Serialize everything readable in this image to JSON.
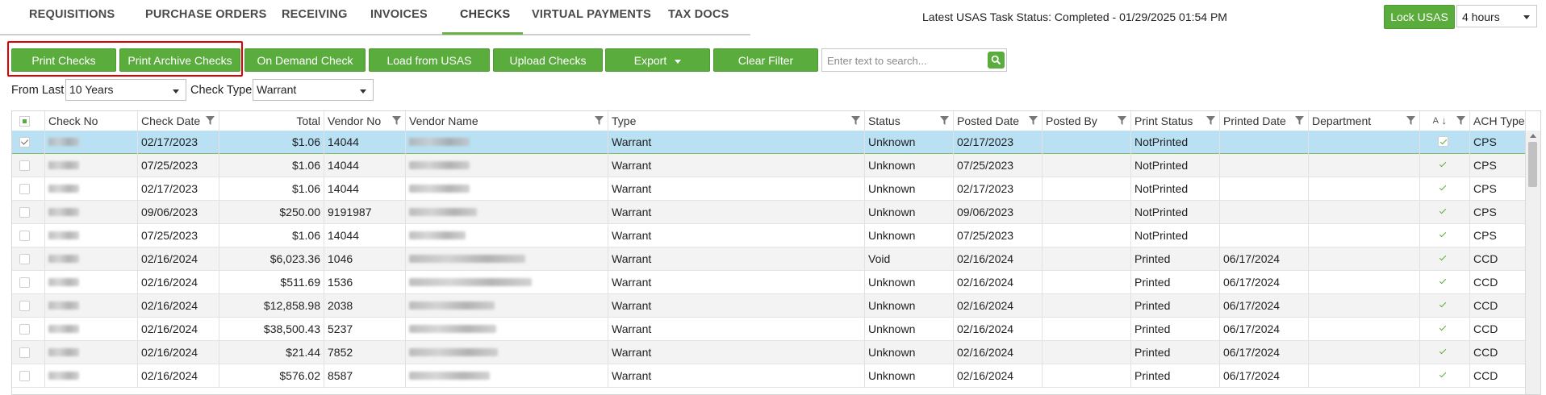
{
  "nav": {
    "tabs": [
      {
        "label": "REQUISITIONS",
        "active": false
      },
      {
        "label": "PURCHASE ORDERS",
        "active": false
      },
      {
        "label": "RECEIVING",
        "active": false
      },
      {
        "label": "INVOICES",
        "active": false
      },
      {
        "label": "CHECKS",
        "active": true
      },
      {
        "label": "VIRTUAL PAYMENTS",
        "active": false
      },
      {
        "label": "TAX DOCS",
        "active": false
      }
    ]
  },
  "header": {
    "task_status": "Latest USAS Task Status: Completed - 01/29/2025 01:54 PM",
    "lock_label": "Lock USAS",
    "hours_value": "4 hours"
  },
  "toolbar": {
    "print_checks": "Print Checks",
    "print_archive_checks": "Print Archive Checks",
    "on_demand_check": "On Demand Check",
    "load_from_usas": "Load from USAS",
    "upload_checks": "Upload Checks",
    "export": "Export",
    "clear_filter": "Clear Filter",
    "search_placeholder": "Enter text to search..."
  },
  "filters": {
    "from_last_label": "From Last",
    "from_last_value": "10 Years",
    "check_type_label": "Check Type",
    "check_type_value": "Warrant"
  },
  "colors": {
    "accent": "#5aad3c",
    "selected_row": "#b9e0f3",
    "highlight_border": "#e00000"
  },
  "grid": {
    "columns": [
      "Check No",
      "Check Date",
      "Total",
      "Vendor No",
      "Vendor Name",
      "Type",
      "Status",
      "Posted Date",
      "Posted By",
      "Print Status",
      "Printed Date",
      "Department",
      "A",
      "ACH Type"
    ],
    "rows": [
      {
        "checked": true,
        "check_date": "02/17/2023",
        "total": "$1.06",
        "vendor_no": "14044",
        "type": "Warrant",
        "status": "Unknown",
        "posted_date": "02/17/2023",
        "posted_by": "",
        "print_status": "NotPrinted",
        "printed_date": "",
        "department": "",
        "ach_type": "CPS"
      },
      {
        "checked": false,
        "check_date": "07/25/2023",
        "total": "$1.06",
        "vendor_no": "14044",
        "type": "Warrant",
        "status": "Unknown",
        "posted_date": "07/25/2023",
        "posted_by": "",
        "print_status": "NotPrinted",
        "printed_date": "",
        "department": "",
        "ach_type": "CPS"
      },
      {
        "checked": false,
        "check_date": "02/17/2023",
        "total": "$1.06",
        "vendor_no": "14044",
        "type": "Warrant",
        "status": "Unknown",
        "posted_date": "02/17/2023",
        "posted_by": "",
        "print_status": "NotPrinted",
        "printed_date": "",
        "department": "",
        "ach_type": "CPS"
      },
      {
        "checked": false,
        "check_date": "09/06/2023",
        "total": "$250.00",
        "vendor_no": "9191987",
        "type": "Warrant",
        "status": "Unknown",
        "posted_date": "09/06/2023",
        "posted_by": "",
        "print_status": "NotPrinted",
        "printed_date": "",
        "department": "",
        "ach_type": "CPS"
      },
      {
        "checked": false,
        "check_date": "07/25/2023",
        "total": "$1.06",
        "vendor_no": "14044",
        "type": "Warrant",
        "status": "Unknown",
        "posted_date": "07/25/2023",
        "posted_by": "",
        "print_status": "NotPrinted",
        "printed_date": "",
        "department": "",
        "ach_type": "CPS"
      },
      {
        "checked": false,
        "check_date": "02/16/2024",
        "total": "$6,023.36",
        "vendor_no": "1046",
        "type": "Warrant",
        "status": "Void",
        "posted_date": "02/16/2024",
        "posted_by": "",
        "print_status": "Printed",
        "printed_date": "06/17/2024",
        "department": "",
        "ach_type": "CCD"
      },
      {
        "checked": false,
        "check_date": "02/16/2024",
        "total": "$511.69",
        "vendor_no": "1536",
        "type": "Warrant",
        "status": "Unknown",
        "posted_date": "02/16/2024",
        "posted_by": "",
        "print_status": "Printed",
        "printed_date": "06/17/2024",
        "department": "",
        "ach_type": "CCD"
      },
      {
        "checked": false,
        "check_date": "02/16/2024",
        "total": "$12,858.98",
        "vendor_no": "2038",
        "type": "Warrant",
        "status": "Unknown",
        "posted_date": "02/16/2024",
        "posted_by": "",
        "print_status": "Printed",
        "printed_date": "06/17/2024",
        "department": "",
        "ach_type": "CCD"
      },
      {
        "checked": false,
        "check_date": "02/16/2024",
        "total": "$38,500.43",
        "vendor_no": "5237",
        "type": "Warrant",
        "status": "Unknown",
        "posted_date": "02/16/2024",
        "posted_by": "",
        "print_status": "Printed",
        "printed_date": "06/17/2024",
        "department": "",
        "ach_type": "CCD"
      },
      {
        "checked": false,
        "check_date": "02/16/2024",
        "total": "$21.44",
        "vendor_no": "7852",
        "type": "Warrant",
        "status": "Unknown",
        "posted_date": "02/16/2024",
        "posted_by": "",
        "print_status": "Printed",
        "printed_date": "06/17/2024",
        "department": "",
        "ach_type": "CCD"
      },
      {
        "checked": false,
        "check_date": "02/16/2024",
        "total": "$576.02",
        "vendor_no": "8587",
        "type": "Warrant",
        "status": "Unknown",
        "posted_date": "02/16/2024",
        "posted_by": "",
        "print_status": "Printed",
        "printed_date": "06/17/2024",
        "department": "",
        "ach_type": "CCD"
      }
    ]
  }
}
